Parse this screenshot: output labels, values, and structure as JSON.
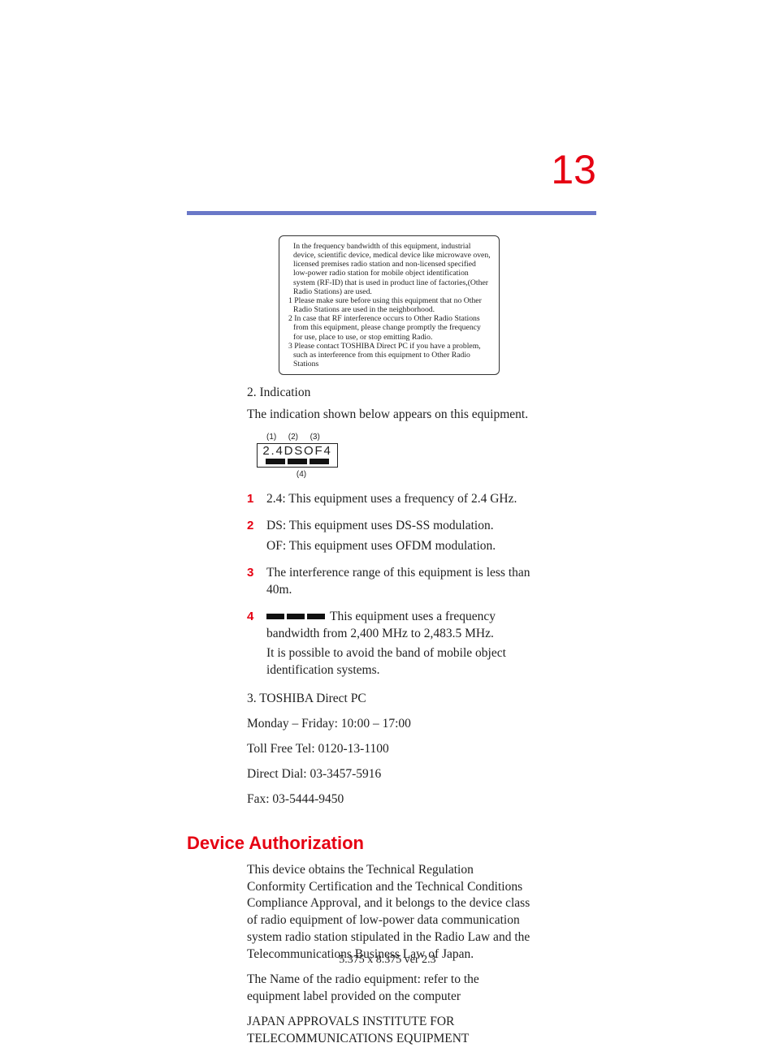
{
  "page_number": "13",
  "boxed_note": {
    "intro": "In the frequency bandwidth of this equipment, industrial device, scientific device, medical device like microwave oven, licensed premises radio station and non-licensed specified low-power radio station for mobile object identification system (RF-ID) that is used in product line of factories,(Other Radio Stations) are used.",
    "item1": "1 Please make sure before using this equipment that no Other Radio Stations are used in the neighborhood.",
    "item2": "2 In case that RF interference occurs to Other Radio Stations from this equipment, please change promptly the frequency for use, place to use, or stop emitting Radio.",
    "item3": "3 Please contact TOSHIBA Direct PC if you have a problem, such as interference from this equipment to Other Radio Stations"
  },
  "indication": {
    "heading": "2. Indication",
    "lead": "The indication shown below appears on this equipment.",
    "top_labels": {
      "l1": "(1)",
      "l2": "(2)",
      "l3": "(3)"
    },
    "label_text": "2.4DSOF4",
    "bottom_label": "(4)"
  },
  "list": {
    "n1": {
      "num": "1",
      "text": "2.4: This equipment uses a frequency of 2.4 GHz."
    },
    "n2": {
      "num": "2",
      "line1": "DS: This equipment uses DS-SS modulation.",
      "line2": "OF: This equipment uses OFDM modulation."
    },
    "n3": {
      "num": "3",
      "text": "The interference range of this equipment is less than 40m."
    },
    "n4": {
      "num": "4",
      "line1": "This equipment uses a frequency bandwidth from 2,400 MHz to 2,483.5 MHz.",
      "line2": "It is possible to avoid the band of mobile object identification systems."
    }
  },
  "contact": {
    "title": "3. TOSHIBA Direct PC",
    "hours": "Monday – Friday: 10:00 – 17:00",
    "toll_free": "Toll Free Tel: 0120-13-1100",
    "direct_dial": "Direct Dial: 03-3457-5916",
    "fax": "Fax: 03-5444-9450"
  },
  "device_auth": {
    "heading": "Device Authorization",
    "p1": "This device obtains the Technical Regulation Conformity Certification and the Technical Conditions Compliance Approval, and it belongs to the device class of radio equipment of low-power data communication system radio station stipulated in the Radio Law and the Telecommunications Business Law of Japan.",
    "p2": "The Name of the radio equipment: refer to the equipment label provided on the computer",
    "p3": "JAPAN APPROVALS INSTITUTE FOR TELECOMMUNICATIONS EQUIPMENT"
  },
  "footer": "5.375 x 8.375 ver 2.3"
}
